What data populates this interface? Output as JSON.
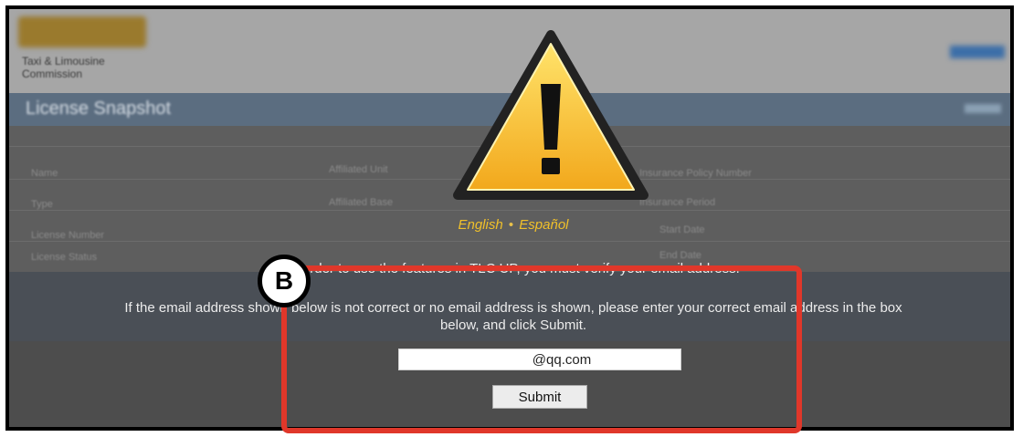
{
  "background": {
    "org_name": "Taxi & Limousine Commission",
    "bar_title": "License Snapshot",
    "fields": [
      "Name",
      "Type",
      "License Number",
      "License Status",
      "Affiliated Unit",
      "Affiliated Base",
      "Insurance Policy Number",
      "Insurance Period",
      "Start Date",
      "End Date"
    ]
  },
  "dialog": {
    "language": {
      "english": "English",
      "separator": "•",
      "spanish": "Español"
    },
    "message_line1": "In order to use the features in TLC UP, you must verify your email address.",
    "message_line2": "If the email address shown below is not correct or no email address is shown, please enter your correct email address in the box",
    "message_line3": "below, and click Submit.",
    "email_value": "@qq.com",
    "submit_label": "Submit"
  },
  "annotation": {
    "badge_letter": "B",
    "color": "#e0372a"
  },
  "colors": {
    "warning_yellow": "#f5c518",
    "language_text": "#f0c02a"
  }
}
